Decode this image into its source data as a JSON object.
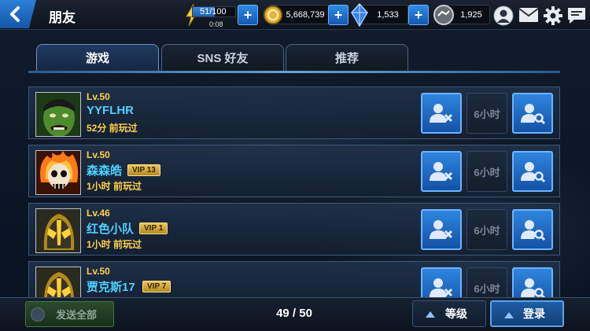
{
  "header": {
    "title": "朋友",
    "energy": {
      "value": "51/100",
      "timer": "0:08",
      "fill": 0.51
    },
    "gold": "5,668,739",
    "crystals": "1,533",
    "units": "1,925"
  },
  "tabs": [
    {
      "label": "游戏",
      "active": true
    },
    {
      "label": "SNS 好友",
      "active": false
    },
    {
      "label": "推荐",
      "active": false
    }
  ],
  "friends": [
    {
      "level": "Lv.50",
      "name": "YYFLHR",
      "vip": "",
      "last_played": "52分 前玩过",
      "cooldown": "6小时",
      "avatar": "hulk-avatar"
    },
    {
      "level": "Lv.50",
      "name": "森森皓",
      "vip": "VIP 13",
      "last_played": "1小时 前玩过",
      "cooldown": "6小时",
      "avatar": "ghost-rider-avatar"
    },
    {
      "level": "Lv.46",
      "name": "红色小队",
      "vip": "VIP 1",
      "last_played": "1小时 前玩过",
      "cooldown": "6小时",
      "avatar": "yellowjacket-avatar"
    },
    {
      "level": "Lv.50",
      "name": "贾克斯17",
      "vip": "VIP 7",
      "last_played": "",
      "cooldown": "6小时",
      "avatar": "yellowjacket-avatar"
    }
  ],
  "footer": {
    "send_all": "发送全部",
    "page": "49 / 50",
    "sort_level": "等级",
    "sort_login": "登录"
  },
  "colors": {
    "accent_blue": "#2f85de",
    "level_gold": "#ffd24a",
    "name_cyan": "#4fd1ff"
  }
}
